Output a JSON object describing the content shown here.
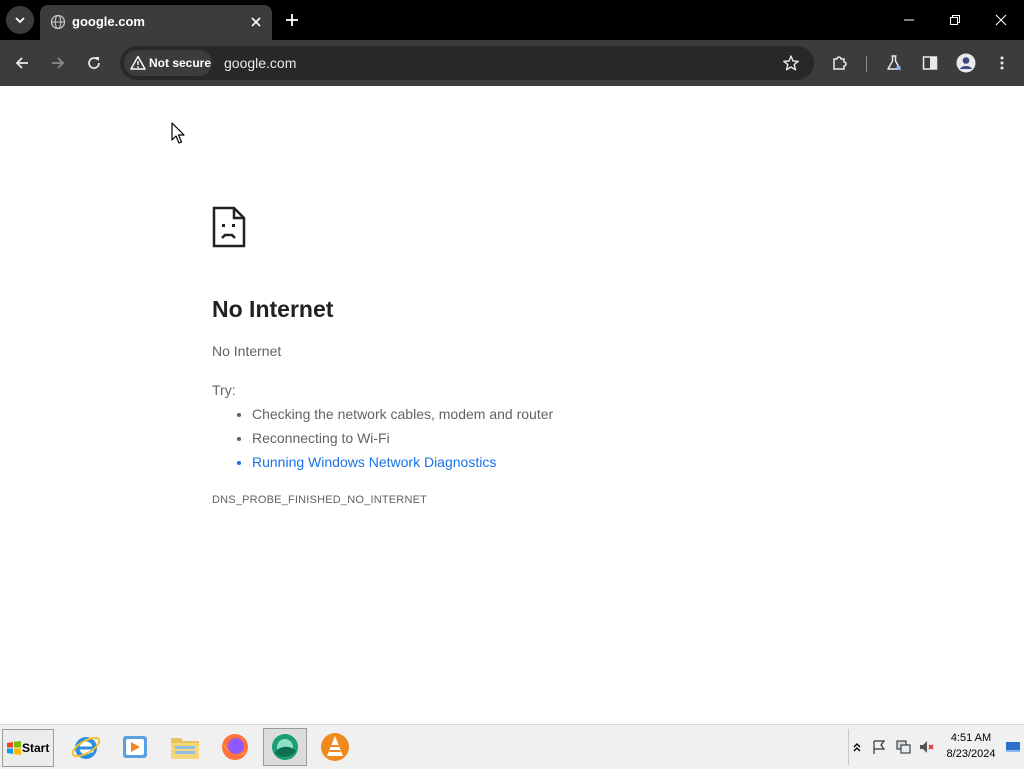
{
  "browser": {
    "tab": {
      "title": "google.com"
    },
    "omnibox": {
      "security_label": "Not secure",
      "url": "google.com"
    }
  },
  "error_page": {
    "title": "No Internet",
    "subtitle": "No Internet",
    "try_label": "Try:",
    "suggestions": [
      "Checking the network cables, modem and router",
      "Reconnecting to Wi-Fi",
      "Running Windows Network Diagnostics"
    ],
    "error_code": "DNS_PROBE_FINISHED_NO_INTERNET"
  },
  "taskbar": {
    "start_label": "Start",
    "apps": [
      "internet-explorer-icon",
      "media-player-icon",
      "file-explorer-icon",
      "firefox-icon",
      "chrome-icon",
      "vlc-icon"
    ],
    "clock": {
      "time": "4:51 AM",
      "date": "8/23/2024"
    }
  },
  "colors": {
    "titlebar": "#000000",
    "toolbar": "#3c3c3c",
    "link": "#1a73e8",
    "body_text": "#5f6368",
    "heading": "#202124"
  }
}
